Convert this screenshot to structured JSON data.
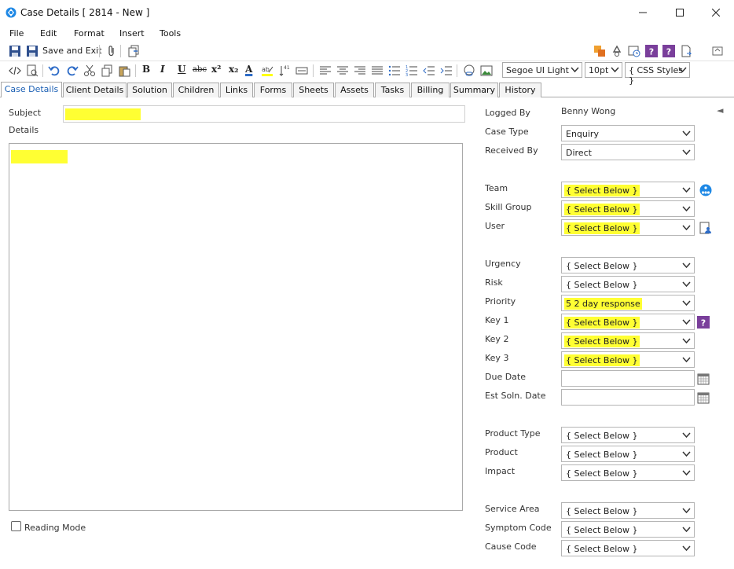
{
  "window": {
    "title": "Case Details [ 2814 - New ]"
  },
  "menu": [
    "File",
    "Edit",
    "Format",
    "Insert",
    "Tools"
  ],
  "toolbar": {
    "save_exit_label": "Save and Exit"
  },
  "formatbar": {
    "font": "Segoe UI Light",
    "size": "10pt",
    "styles": "{ CSS Styles }",
    "bold": "B",
    "italic": "I",
    "underline": "U",
    "strike": "abc",
    "superscript": "x²",
    "subscript": "x₂",
    "font_color": "A"
  },
  "tabs": [
    "Case Details",
    "Client Details",
    "Solution",
    "Children",
    "Links",
    "Forms",
    "Sheets",
    "Assets",
    "Tasks",
    "Billing",
    "Summary",
    "History"
  ],
  "left": {
    "subject_label": "Subject",
    "details_label": "Details",
    "reading_mode_label": "Reading Mode"
  },
  "right": {
    "logged_by_label": "Logged By",
    "logged_by_value": "Benny Wong",
    "fields": [
      {
        "label": "Case Type",
        "value": "Enquiry"
      },
      {
        "label": "Received By",
        "value": "Direct"
      },
      {
        "label": "Team",
        "value": "{ Select Below }"
      },
      {
        "label": "Skill Group",
        "value": "{ Select Below }"
      },
      {
        "label": "User",
        "value": "{ Select Below }"
      },
      {
        "label": "Urgency",
        "value": "{ Select Below }"
      },
      {
        "label": "Risk",
        "value": "{ Select Below }"
      },
      {
        "label": "Priority",
        "value": "5 2 day response"
      },
      {
        "label": "Key 1",
        "value": "{ Select Below }"
      },
      {
        "label": "Key 2",
        "value": "{ Select Below }"
      },
      {
        "label": "Key 3",
        "value": "{ Select Below }"
      },
      {
        "label": "Product Type",
        "value": "{ Select Below }"
      },
      {
        "label": "Product",
        "value": "{ Select Below }"
      },
      {
        "label": "Impact",
        "value": "{ Select Below }"
      },
      {
        "label": "Service Area",
        "value": "{ Select Below }"
      },
      {
        "label": "Symptom Code",
        "value": "{ Select Below }"
      },
      {
        "label": "Cause Code",
        "value": "{ Select Below }"
      }
    ],
    "due_date_label": "Due Date",
    "est_soln_date_label": "Est Soln. Date",
    "collapse_glyph": "◄"
  },
  "colors": {
    "highlight": "#ffff33",
    "accent": "#1a5fb4",
    "purple": "#7a3f9b"
  }
}
